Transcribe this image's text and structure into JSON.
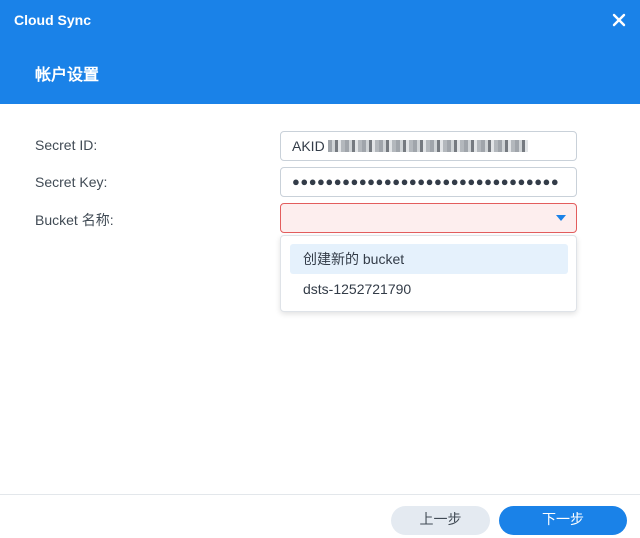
{
  "window": {
    "app_title": "Cloud Sync",
    "close_icon": "close-icon"
  },
  "header": {
    "page_title": "帐户设置"
  },
  "form": {
    "secret_id": {
      "label": "Secret ID:",
      "value_visible_prefix": "AKID"
    },
    "secret_key": {
      "label": "Secret Key:",
      "value": "●●●●●●●●●●●●●●●●●●●●●●●●●●●●●●●●"
    },
    "bucket": {
      "label": "Bucket 名称:",
      "value": "",
      "arrow_icon": "chevron-down-icon",
      "options": [
        "创建新的 bucket",
        "dsts-1252721790"
      ]
    }
  },
  "footer": {
    "prev_label": "上一步",
    "next_label": "下一步"
  },
  "colors": {
    "accent": "#1a82e8",
    "error_border": "#e35d5d",
    "error_background": "#fdeeee",
    "option_highlight": "#e5f1fc"
  }
}
